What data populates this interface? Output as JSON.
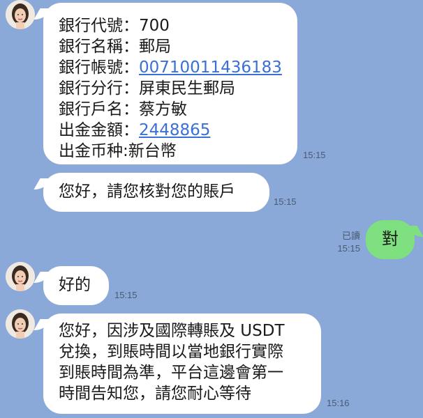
{
  "messages": [
    {
      "sender": "other",
      "lines": [
        {
          "label": "銀行代號：",
          "value": "700"
        },
        {
          "label": "銀行名稱：",
          "value": "郵局"
        },
        {
          "label": "銀行帳號：",
          "value": "00710011436183",
          "link": true
        },
        {
          "label": "銀行分行：",
          "value": "屏東民生郵局"
        },
        {
          "label": "銀行戶名：",
          "value": "蔡方敏"
        },
        {
          "label": "出金金額：",
          "value": "2448865",
          "link": true
        },
        {
          "label": "出金币种:",
          "value": "新台幣"
        }
      ],
      "time": "15:15"
    },
    {
      "sender": "other",
      "text": "您好，請您核對您的賬戶",
      "time": "15:15"
    },
    {
      "sender": "me",
      "text": "對",
      "read_label": "已讀",
      "time": "15:15"
    },
    {
      "sender": "other",
      "text": "好的",
      "time": "15:15"
    },
    {
      "sender": "other",
      "lines_plain": [
        "您好，因涉及國際轉賬及 USDT",
        "兌換，到賬時間以當地銀行實際",
        "到賬時間為準，平台這邊會第一",
        "時間告知您，請您耐心等待"
      ],
      "time": "15:16"
    }
  ],
  "colors": {
    "background": "#8aa9d8",
    "bubble_other": "#ffffff",
    "bubble_me": "#7fe07f",
    "link": "#3a6fd8"
  }
}
